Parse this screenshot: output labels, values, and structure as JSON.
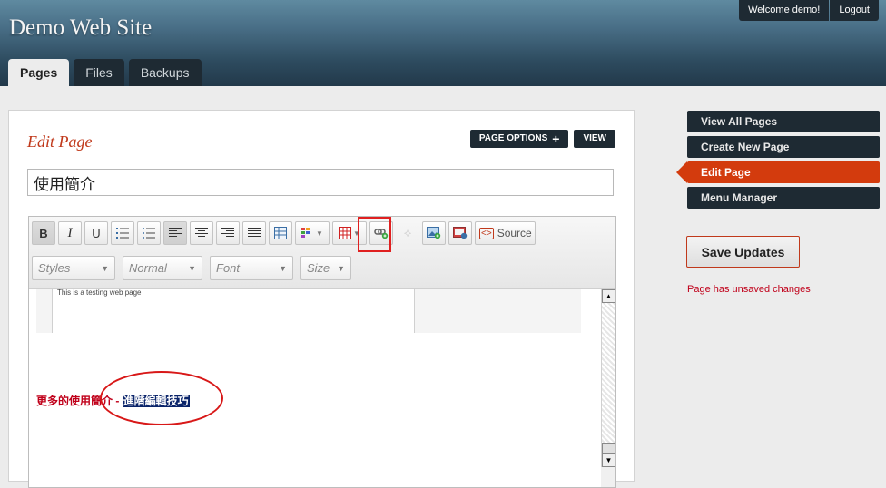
{
  "header": {
    "site_title": "Demo Web Site",
    "welcome": "Welcome demo!",
    "logout": "Logout",
    "tabs": [
      {
        "label": "Pages",
        "active": true
      },
      {
        "label": "Files",
        "active": false
      },
      {
        "label": "Backups",
        "active": false
      }
    ]
  },
  "panel": {
    "title": "Edit Page",
    "page_options": "PAGE OPTIONS",
    "view": "VIEW",
    "page_title_value": "使用簡介"
  },
  "editor": {
    "toolbar": {
      "bold": "B",
      "italic": "I",
      "underline": "U",
      "source": "Source",
      "styles": "Styles",
      "format": "Normal",
      "font": "Font",
      "size": "Size"
    },
    "preview_text": "This is a testing web page",
    "content_prefix": "更多的使用簡介 - ",
    "content_selected": "進階編輯技巧"
  },
  "sidebar": {
    "items": [
      {
        "label": "View All Pages",
        "active": false
      },
      {
        "label": "Create New Page",
        "active": false
      },
      {
        "label": "Edit Page",
        "active": true
      },
      {
        "label": "Menu Manager",
        "active": false
      }
    ],
    "save_button": "Save Updates",
    "unsaved_message": "Page has unsaved changes"
  },
  "colors": {
    "accent_red": "#c0391b",
    "nav_dark": "#1e2a33",
    "active_orange": "#d33b0d"
  }
}
